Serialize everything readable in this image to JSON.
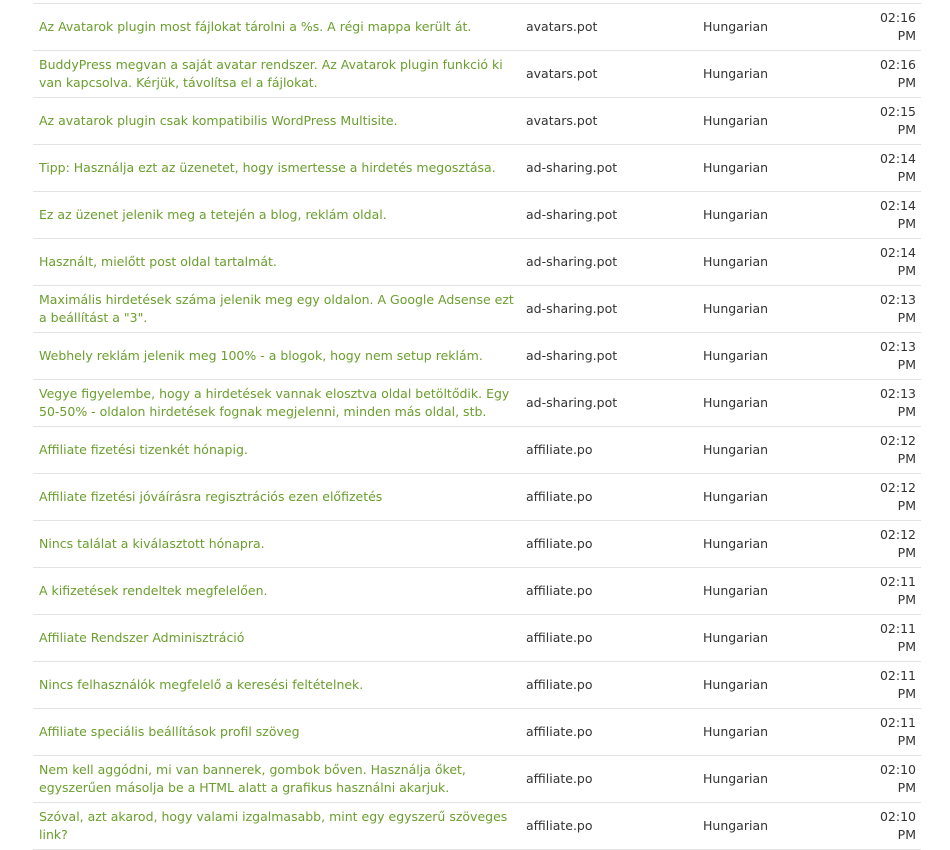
{
  "rows": [
    {
      "text": "Az Avatarok plugin most fájlokat tárolni a %s. A régi mappa került át.",
      "file": "avatars.pot",
      "language": "Hungarian",
      "time": "02:16 PM"
    },
    {
      "text": "BuddyPress megvan a saját avatar rendszer. Az Avatarok plugin funkció ki van kapcsolva. Kérjük, távolítsa el a fájlokat.",
      "file": "avatars.pot",
      "language": "Hungarian",
      "time": "02:16 PM"
    },
    {
      "text": "Az avatarok plugin csak kompatibilis WordPress Multisite.",
      "file": "avatars.pot",
      "language": "Hungarian",
      "time": "02:15 PM"
    },
    {
      "text": "Tipp: Használja ezt az üzenetet, hogy ismertesse a hirdetés megosztása.",
      "file": "ad-sharing.pot",
      "language": "Hungarian",
      "time": "02:14 PM"
    },
    {
      "text": "Ez az üzenet jelenik meg a tetején a blog, reklám oldal.",
      "file": "ad-sharing.pot",
      "language": "Hungarian",
      "time": "02:14 PM"
    },
    {
      "text": "Használt, mielőtt post oldal tartalmát.",
      "file": "ad-sharing.pot",
      "language": "Hungarian",
      "time": "02:14 PM"
    },
    {
      "text": "Maximális hirdetések száma jelenik meg egy oldalon. A Google Adsense ezt a beállítást a \"3\".",
      "file": "ad-sharing.pot",
      "language": "Hungarian",
      "time": "02:13 PM"
    },
    {
      "text": "Webhely reklám jelenik meg 100% - a blogok, hogy nem setup reklám.",
      "file": "ad-sharing.pot",
      "language": "Hungarian",
      "time": "02:13 PM"
    },
    {
      "text": "Vegye figyelembe, hogy a hirdetések vannak elosztva oldal betöltődik. Egy 50-50% - oldalon hirdetések fognak megjelenni, minden más oldal, stb.",
      "file": "ad-sharing.pot",
      "language": "Hungarian",
      "time": "02:13 PM"
    },
    {
      "text": "Affiliate fizetési tizenkét hónapig.",
      "file": "affiliate.po",
      "language": "Hungarian",
      "time": "02:12 PM"
    },
    {
      "text": "Affiliate fizetési jóváírásra regisztrációs ezen előfizetés",
      "file": "affiliate.po",
      "language": "Hungarian",
      "time": "02:12 PM"
    },
    {
      "text": "Nincs találat a kiválasztott hónapra.",
      "file": "affiliate.po",
      "language": "Hungarian",
      "time": "02:12 PM"
    },
    {
      "text": "A kifizetések rendeltek megfelelően.",
      "file": "affiliate.po",
      "language": "Hungarian",
      "time": "02:11 PM"
    },
    {
      "text": "Affiliate Rendszer Adminisztráció",
      "file": "affiliate.po",
      "language": "Hungarian",
      "time": "02:11 PM"
    },
    {
      "text": "Nincs felhasználók megfelelő a keresési feltételnek.",
      "file": "affiliate.po",
      "language": "Hungarian",
      "time": "02:11 PM"
    },
    {
      "text": "Affiliate speciális beállítások profil szöveg",
      "file": "affiliate.po",
      "language": "Hungarian",
      "time": "02:11 PM"
    },
    {
      "text": "Nem kell aggódni, mi van bannerek, gombok bőven. Használja őket, egyszerűen másolja be a HTML alatt a grafikus használni akarjuk.",
      "file": "affiliate.po",
      "language": "Hungarian",
      "time": "02:10 PM"
    },
    {
      "text": "Szóval, azt akarod, hogy valami izgalmasabb, mint egy egyszerű szöveges link?",
      "file": "affiliate.po",
      "language": "Hungarian",
      "time": "02:10 PM"
    }
  ]
}
